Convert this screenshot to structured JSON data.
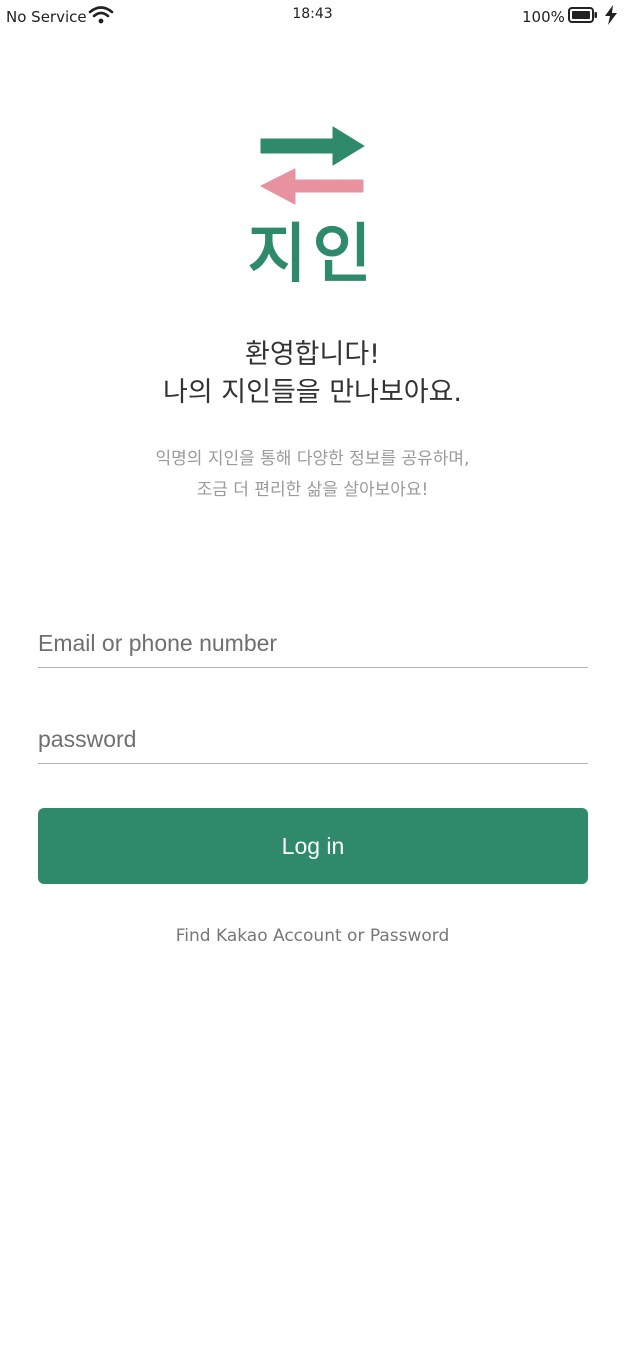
{
  "status_bar": {
    "carrier": "No Service",
    "time": "18:43",
    "battery": "100%"
  },
  "icons": {
    "wifi": "wifi-icon",
    "battery": "battery-icon",
    "charging": "charging-bolt-icon",
    "logo": "exchange-arrows-icon"
  },
  "colors": {
    "brand_green": "#2f8a6b",
    "brand_pink": "#e8929f"
  },
  "logo": {
    "text": "지인"
  },
  "welcome": {
    "line1": "환영합니다!",
    "line2": "나의 지인들을 만나보아요."
  },
  "subtitle": {
    "line1": "익명의 지인을 통해 다양한 정보를 공유하며,",
    "line2": "조금 더 편리한 삶을 살아보아요!"
  },
  "form": {
    "email_placeholder": "Email or phone number",
    "email_value": "",
    "password_placeholder": "password",
    "password_value": "",
    "login_label": "Log in",
    "find_account_label": "Find Kakao Account or Password"
  }
}
